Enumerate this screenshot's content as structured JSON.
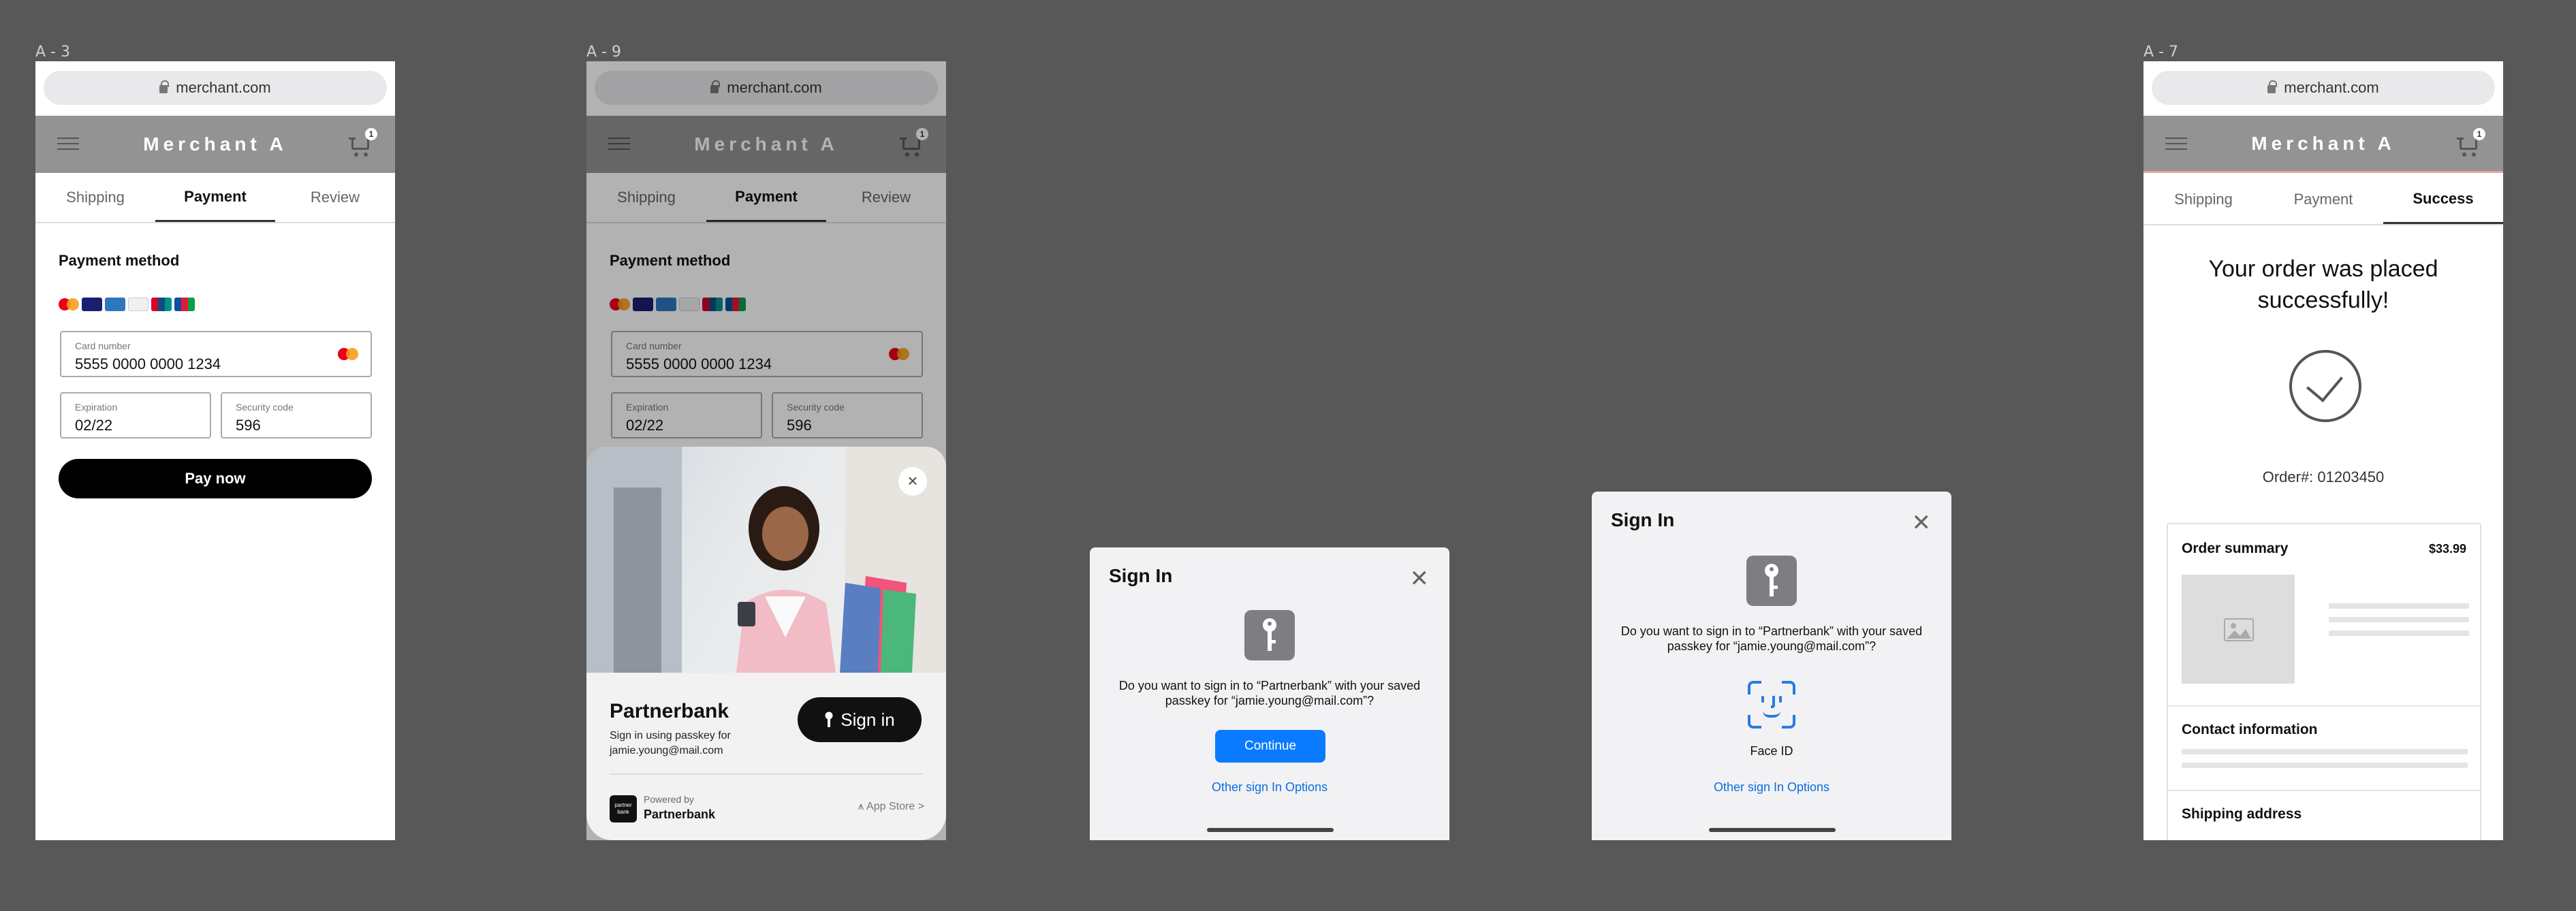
{
  "frames": {
    "a3": {
      "label": "A - 3"
    },
    "a9": {
      "label": "A - 9"
    },
    "a7": {
      "label": "A - 7"
    }
  },
  "browser": {
    "url": "merchant.com"
  },
  "store": {
    "title": "Merchant A",
    "cart_count": "1"
  },
  "tabs": {
    "shipping": "Shipping",
    "payment": "Payment",
    "review": "Review",
    "success": "Success"
  },
  "payment": {
    "section_title": "Payment method",
    "card_logos": [
      "mastercard-icon",
      "visa-icon",
      "amex-icon",
      "discover-icon",
      "unionpay-icon",
      "jcb-icon"
    ],
    "card_number_label": "Card number",
    "card_number": "5555 0000 0000 1234",
    "expiration_label": "Expiration",
    "expiration": "02/22",
    "security_label": "Security code",
    "security": "596",
    "pay_button": "Pay now"
  },
  "partner_sheet": {
    "close": "×",
    "title": "Partnerbank",
    "subtitle": "Sign in using passkey for jamie.young@mail.com",
    "signin_button": "Sign in",
    "logo_text": "partner bank",
    "powered_by": "Powered by",
    "powered_name": "Partnerbank",
    "app_store": "App Store >"
  },
  "dialog1": {
    "title": "Sign In",
    "close": "✕",
    "message": "Do you want to sign in to “Partnerbank” with your saved passkey for “jamie.young@mail.com”?",
    "continue_button": "Continue",
    "other_link": "Other sign In Options"
  },
  "dialog2": {
    "title": "Sign In",
    "close": "✕",
    "message": "Do you want to sign in to “Partnerbank” with your saved passkey for “jamie.young@mail.com”?",
    "faceid_label": "Face ID",
    "other_link": "Other sign In Options"
  },
  "success": {
    "title_line1": "Your order was placed",
    "title_line2": "successfully!",
    "order_number": "Order#: 01203450",
    "summary_title": "Order summary",
    "summary_price": "$33.99",
    "contact_title": "Contact information",
    "shipping_title": "Shipping address"
  },
  "colors": {
    "background": "#585858",
    "header": "#939393",
    "ios_blue": "#0a7aff",
    "success_header_rule": "#e8a0a0"
  }
}
